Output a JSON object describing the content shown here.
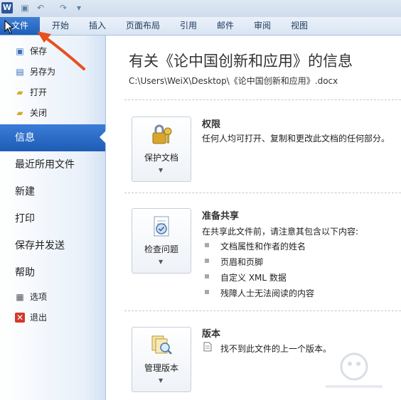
{
  "qat": {
    "logo": "W",
    "icons": [
      "save-icon",
      "undo-icon",
      "redo-icon",
      "customize-icon"
    ]
  },
  "ribbon": {
    "tabs": [
      "文件",
      "开始",
      "插入",
      "页面布局",
      "引用",
      "邮件",
      "审阅",
      "视图"
    ],
    "active": "文件"
  },
  "sidebar": {
    "commands": [
      {
        "label": "保存",
        "icon": "save-icon"
      },
      {
        "label": "另存为",
        "icon": "save-as-icon"
      },
      {
        "label": "打开",
        "icon": "open-folder-icon"
      },
      {
        "label": "关闭",
        "icon": "close-folder-icon"
      }
    ],
    "nav": [
      "信息",
      "最近所用文件",
      "新建",
      "打印",
      "保存并发送",
      "帮助"
    ],
    "active": "信息",
    "options_label": "选项",
    "exit_label": "退出"
  },
  "info": {
    "title": "有关《论中国创新和应用》的信息",
    "path": "C:\\Users\\WeiX\\Desktop\\《论中国创新和应用》.docx",
    "permissions": {
      "button": "保护文档",
      "heading": "权限",
      "text": "任何人均可打开、复制和更改此文档的任何部分。"
    },
    "prepare": {
      "button": "检查问题",
      "heading": "准备共享",
      "text": "在共享此文件前，请注意其包含以下内容:",
      "items": [
        "文档属性和作者的姓名",
        "页眉和页脚",
        "自定义 XML 数据",
        "残障人士无法阅读的内容"
      ]
    },
    "versions": {
      "button": "管理版本",
      "heading": "版本",
      "text": "找不到此文件的上一个版本。"
    }
  },
  "colors": {
    "accent": "#1e5cb5",
    "annotation": "#e8501e"
  }
}
